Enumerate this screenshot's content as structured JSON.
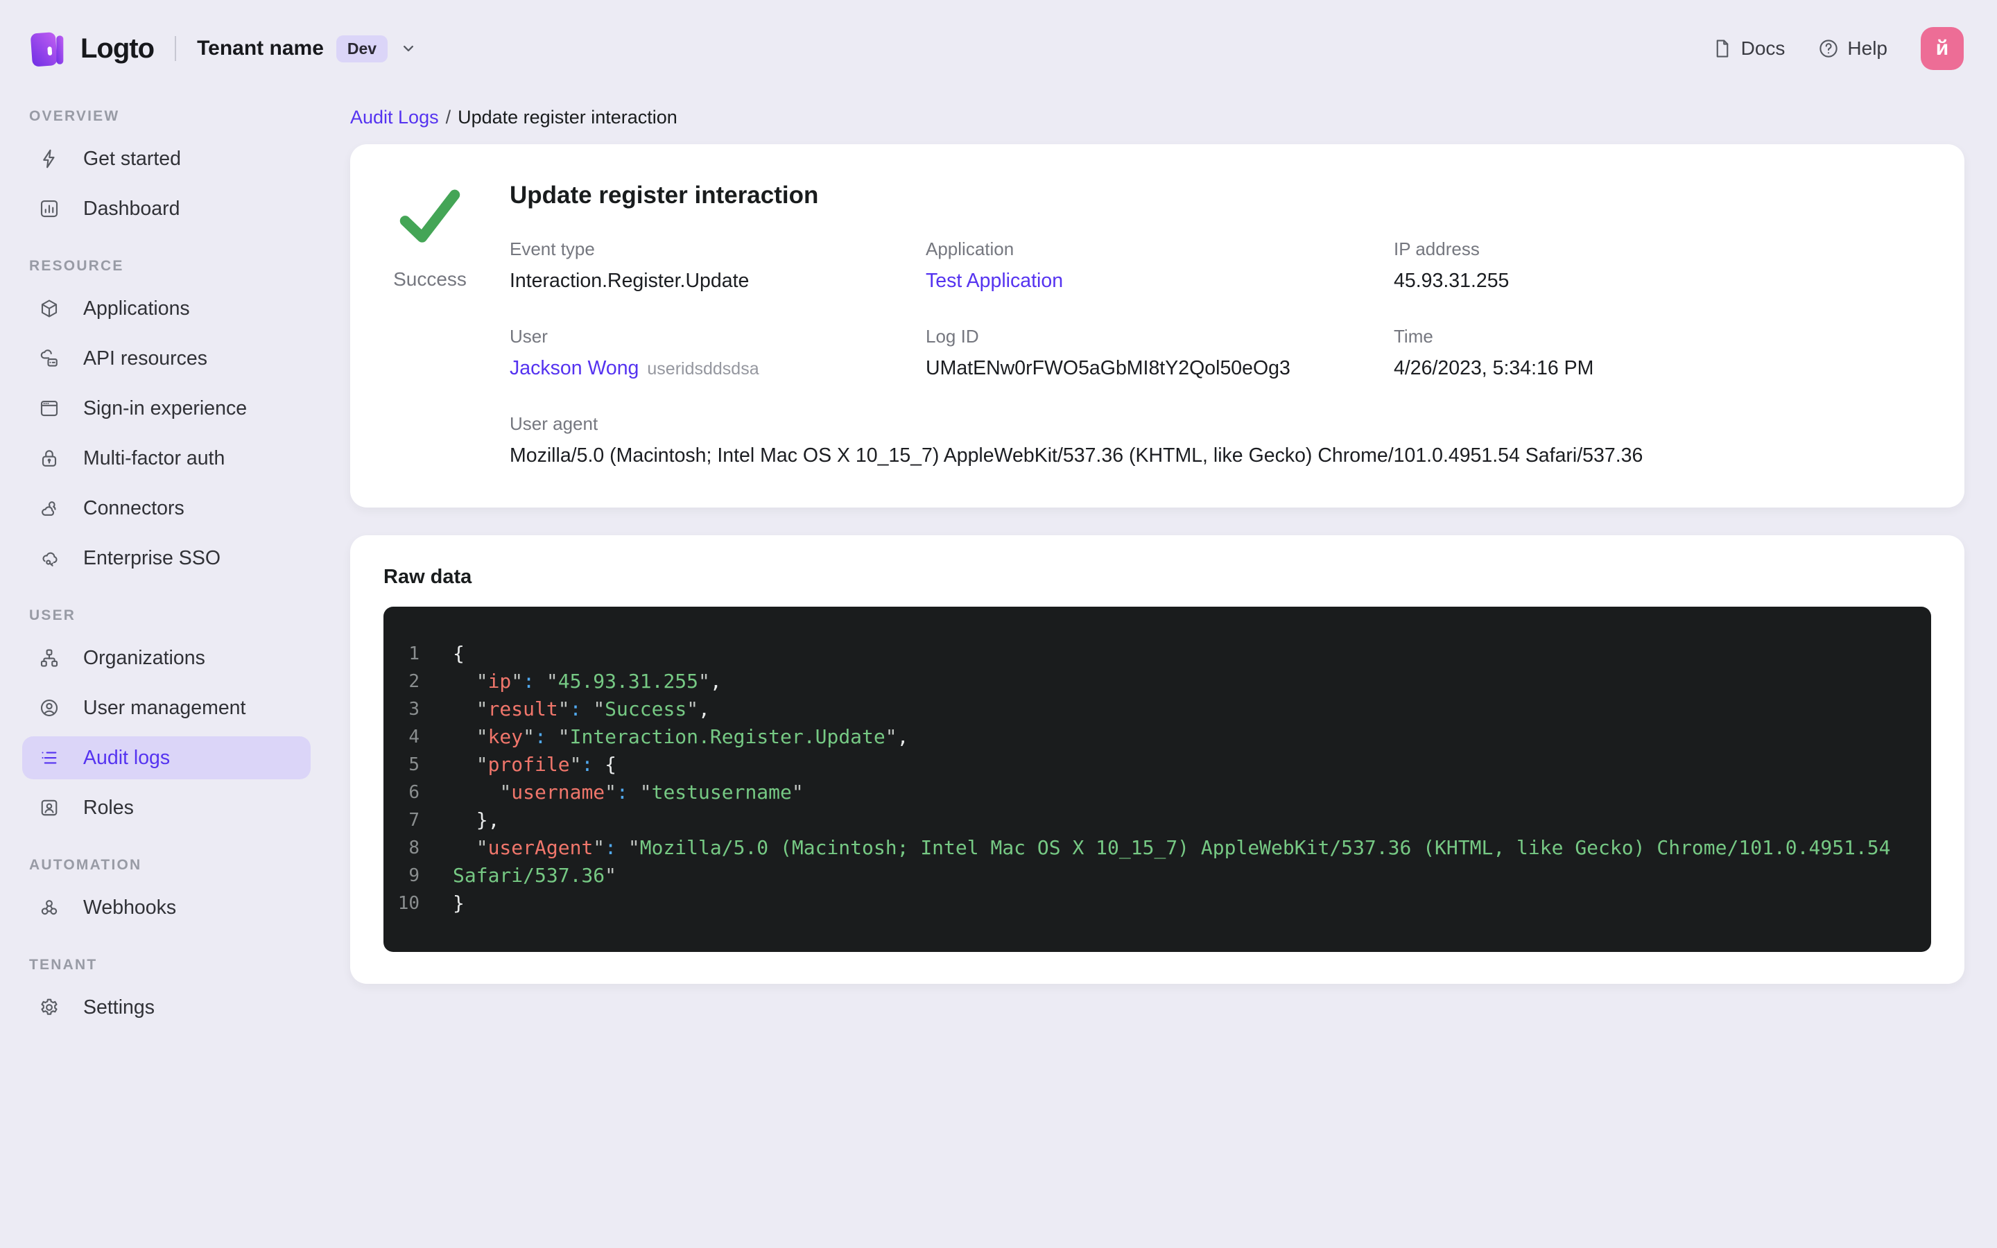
{
  "colors": {
    "accent": "#5533F0",
    "accent_soft": "#DBD5F8",
    "success": "#44A556",
    "avatar_bg": "#ED6D96",
    "page_bg": "#ECEBF4",
    "card_bg": "#FFFFFF",
    "code_bg": "#1A1C1D",
    "tok_key": "#F0766B",
    "tok_string": "#76C984",
    "tok_colon": "#51A9EF",
    "tok_quote": "#C0C4C1",
    "tok_punct": "#E8EAEA",
    "tok_gutter": "#8A8E8F"
  },
  "header": {
    "logo_text": "Logto",
    "tenant_name": "Tenant name",
    "tenant_badge": "Dev",
    "docs_label": "Docs",
    "help_label": "Help",
    "avatar_initial": "й"
  },
  "sidebar": {
    "sections": [
      {
        "label": "OVERVIEW",
        "items": [
          {
            "label": "Get started",
            "icon": "lightning-icon"
          },
          {
            "label": "Dashboard",
            "icon": "dashboard-icon"
          }
        ]
      },
      {
        "label": "RESOURCE",
        "items": [
          {
            "label": "Applications",
            "icon": "box-icon"
          },
          {
            "label": "API resources",
            "icon": "api-resources-icon"
          },
          {
            "label": "Sign-in experience",
            "icon": "browser-icon"
          },
          {
            "label": "Multi-factor auth",
            "icon": "lock-icon"
          },
          {
            "label": "Connectors",
            "icon": "connectors-icon"
          },
          {
            "label": "Enterprise SSO",
            "icon": "cloud-key-icon"
          }
        ]
      },
      {
        "label": "USER",
        "items": [
          {
            "label": "Organizations",
            "icon": "org-chart-icon"
          },
          {
            "label": "User management",
            "icon": "user-circle-icon"
          },
          {
            "label": "Audit logs",
            "icon": "audit-list-icon",
            "active": true
          },
          {
            "label": "Roles",
            "icon": "role-badge-icon"
          }
        ]
      },
      {
        "label": "AUTOMATION",
        "items": [
          {
            "label": "Webhooks",
            "icon": "webhook-icon"
          }
        ]
      },
      {
        "label": "TENANT",
        "items": [
          {
            "label": "Settings",
            "icon": "gear-icon"
          }
        ]
      }
    ]
  },
  "breadcrumb": {
    "parent": "Audit Logs",
    "separator": "/",
    "current": "Update register interaction"
  },
  "detail": {
    "title": "Update register interaction",
    "status": "Success",
    "fields": [
      {
        "label": "Event type",
        "value": "Interaction.Register.Update"
      },
      {
        "label": "Application",
        "value": "Test Application",
        "link": true
      },
      {
        "label": "IP address",
        "value": "45.93.31.255"
      },
      {
        "label": "User",
        "value": "Jackson Wong",
        "link": true,
        "suffix": "useridsddsdsa"
      },
      {
        "label": "Log ID",
        "value": "UMatENw0rFWO5aGbMI8tY2Qol50eOg3"
      },
      {
        "label": "Time",
        "value": "4/26/2023, 5:34:16 PM"
      },
      {
        "label": "User agent",
        "value": "Mozilla/5.0 (Macintosh; Intel Mac OS X 10_15_7) AppleWebKit/537.36 (KHTML, like Gecko) Chrome/101.0.4951.54 Safari/537.36",
        "span": true
      }
    ]
  },
  "raw_data": {
    "title": "Raw data",
    "lines": [
      {
        "num": "1",
        "segments": [
          [
            "p",
            "{"
          ]
        ]
      },
      {
        "num": "2",
        "segments": [
          [
            "w",
            "  "
          ],
          [
            "q",
            "\""
          ],
          [
            "k",
            "ip"
          ],
          [
            "q",
            "\""
          ],
          [
            "c",
            ":"
          ],
          [
            "w",
            " "
          ],
          [
            "q",
            "\""
          ],
          [
            "s",
            "45.93.31.255"
          ],
          [
            "q",
            "\""
          ],
          [
            "p",
            ","
          ]
        ]
      },
      {
        "num": "3",
        "segments": [
          [
            "w",
            "  "
          ],
          [
            "q",
            "\""
          ],
          [
            "k",
            "result"
          ],
          [
            "q",
            "\""
          ],
          [
            "c",
            ":"
          ],
          [
            "w",
            " "
          ],
          [
            "q",
            "\""
          ],
          [
            "s",
            "Success"
          ],
          [
            "q",
            "\""
          ],
          [
            "p",
            ","
          ]
        ]
      },
      {
        "num": "4",
        "segments": [
          [
            "w",
            "  "
          ],
          [
            "q",
            "\""
          ],
          [
            "k",
            "key"
          ],
          [
            "q",
            "\""
          ],
          [
            "c",
            ":"
          ],
          [
            "w",
            " "
          ],
          [
            "q",
            "\""
          ],
          [
            "s",
            "Interaction.Register.Update"
          ],
          [
            "q",
            "\""
          ],
          [
            "p",
            ","
          ]
        ]
      },
      {
        "num": "5",
        "segments": [
          [
            "w",
            "  "
          ],
          [
            "q",
            "\""
          ],
          [
            "k",
            "profile"
          ],
          [
            "q",
            "\""
          ],
          [
            "c",
            ":"
          ],
          [
            "w",
            " "
          ],
          [
            "p",
            "{"
          ]
        ]
      },
      {
        "num": "6",
        "segments": [
          [
            "w",
            "    "
          ],
          [
            "q",
            "\""
          ],
          [
            "k",
            "username"
          ],
          [
            "q",
            "\""
          ],
          [
            "c",
            ":"
          ],
          [
            "w",
            " "
          ],
          [
            "q",
            "\""
          ],
          [
            "s",
            "testusername"
          ],
          [
            "q",
            "\""
          ]
        ]
      },
      {
        "num": "7",
        "segments": [
          [
            "w",
            "  "
          ],
          [
            "p",
            "},"
          ]
        ]
      },
      {
        "num": "8",
        "segments": [
          [
            "w",
            "  "
          ],
          [
            "q",
            "\""
          ],
          [
            "k",
            "userAgent"
          ],
          [
            "q",
            "\""
          ],
          [
            "c",
            ":"
          ],
          [
            "w",
            " "
          ],
          [
            "q",
            "\""
          ],
          [
            "s",
            "Mozilla/5.0 (Macintosh; Intel Mac OS X 10_15_7) AppleWebKit/537.36 (KHTML, like Gecko) Chrome/101.0.4951.54"
          ]
        ]
      },
      {
        "num": "9",
        "segments": [
          [
            "s",
            "Safari/537.36"
          ],
          [
            "q",
            "\""
          ]
        ]
      },
      {
        "num": "10",
        "segments": [
          [
            "p",
            "}"
          ]
        ]
      }
    ]
  }
}
